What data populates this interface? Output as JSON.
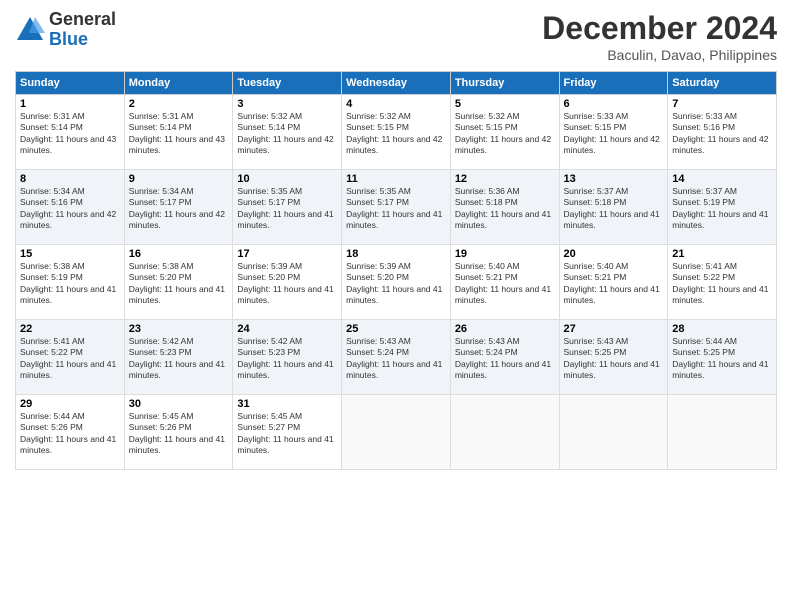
{
  "header": {
    "logo_general": "General",
    "logo_blue": "Blue",
    "month_title": "December 2024",
    "location": "Baculin, Davao, Philippines"
  },
  "weekdays": [
    "Sunday",
    "Monday",
    "Tuesday",
    "Wednesday",
    "Thursday",
    "Friday",
    "Saturday"
  ],
  "weeks": [
    [
      {
        "day": "1",
        "sunrise": "5:31 AM",
        "sunset": "5:14 PM",
        "daylight": "11 hours and 43 minutes."
      },
      {
        "day": "2",
        "sunrise": "5:31 AM",
        "sunset": "5:14 PM",
        "daylight": "11 hours and 43 minutes."
      },
      {
        "day": "3",
        "sunrise": "5:32 AM",
        "sunset": "5:14 PM",
        "daylight": "11 hours and 42 minutes."
      },
      {
        "day": "4",
        "sunrise": "5:32 AM",
        "sunset": "5:15 PM",
        "daylight": "11 hours and 42 minutes."
      },
      {
        "day": "5",
        "sunrise": "5:32 AM",
        "sunset": "5:15 PM",
        "daylight": "11 hours and 42 minutes."
      },
      {
        "day": "6",
        "sunrise": "5:33 AM",
        "sunset": "5:15 PM",
        "daylight": "11 hours and 42 minutes."
      },
      {
        "day": "7",
        "sunrise": "5:33 AM",
        "sunset": "5:16 PM",
        "daylight": "11 hours and 42 minutes."
      }
    ],
    [
      {
        "day": "8",
        "sunrise": "5:34 AM",
        "sunset": "5:16 PM",
        "daylight": "11 hours and 42 minutes."
      },
      {
        "day": "9",
        "sunrise": "5:34 AM",
        "sunset": "5:17 PM",
        "daylight": "11 hours and 42 minutes."
      },
      {
        "day": "10",
        "sunrise": "5:35 AM",
        "sunset": "5:17 PM",
        "daylight": "11 hours and 41 minutes."
      },
      {
        "day": "11",
        "sunrise": "5:35 AM",
        "sunset": "5:17 PM",
        "daylight": "11 hours and 41 minutes."
      },
      {
        "day": "12",
        "sunrise": "5:36 AM",
        "sunset": "5:18 PM",
        "daylight": "11 hours and 41 minutes."
      },
      {
        "day": "13",
        "sunrise": "5:37 AM",
        "sunset": "5:18 PM",
        "daylight": "11 hours and 41 minutes."
      },
      {
        "day": "14",
        "sunrise": "5:37 AM",
        "sunset": "5:19 PM",
        "daylight": "11 hours and 41 minutes."
      }
    ],
    [
      {
        "day": "15",
        "sunrise": "5:38 AM",
        "sunset": "5:19 PM",
        "daylight": "11 hours and 41 minutes."
      },
      {
        "day": "16",
        "sunrise": "5:38 AM",
        "sunset": "5:20 PM",
        "daylight": "11 hours and 41 minutes."
      },
      {
        "day": "17",
        "sunrise": "5:39 AM",
        "sunset": "5:20 PM",
        "daylight": "11 hours and 41 minutes."
      },
      {
        "day": "18",
        "sunrise": "5:39 AM",
        "sunset": "5:20 PM",
        "daylight": "11 hours and 41 minutes."
      },
      {
        "day": "19",
        "sunrise": "5:40 AM",
        "sunset": "5:21 PM",
        "daylight": "11 hours and 41 minutes."
      },
      {
        "day": "20",
        "sunrise": "5:40 AM",
        "sunset": "5:21 PM",
        "daylight": "11 hours and 41 minutes."
      },
      {
        "day": "21",
        "sunrise": "5:41 AM",
        "sunset": "5:22 PM",
        "daylight": "11 hours and 41 minutes."
      }
    ],
    [
      {
        "day": "22",
        "sunrise": "5:41 AM",
        "sunset": "5:22 PM",
        "daylight": "11 hours and 41 minutes."
      },
      {
        "day": "23",
        "sunrise": "5:42 AM",
        "sunset": "5:23 PM",
        "daylight": "11 hours and 41 minutes."
      },
      {
        "day": "24",
        "sunrise": "5:42 AM",
        "sunset": "5:23 PM",
        "daylight": "11 hours and 41 minutes."
      },
      {
        "day": "25",
        "sunrise": "5:43 AM",
        "sunset": "5:24 PM",
        "daylight": "11 hours and 41 minutes."
      },
      {
        "day": "26",
        "sunrise": "5:43 AM",
        "sunset": "5:24 PM",
        "daylight": "11 hours and 41 minutes."
      },
      {
        "day": "27",
        "sunrise": "5:43 AM",
        "sunset": "5:25 PM",
        "daylight": "11 hours and 41 minutes."
      },
      {
        "day": "28",
        "sunrise": "5:44 AM",
        "sunset": "5:25 PM",
        "daylight": "11 hours and 41 minutes."
      }
    ],
    [
      {
        "day": "29",
        "sunrise": "5:44 AM",
        "sunset": "5:26 PM",
        "daylight": "11 hours and 41 minutes."
      },
      {
        "day": "30",
        "sunrise": "5:45 AM",
        "sunset": "5:26 PM",
        "daylight": "11 hours and 41 minutes."
      },
      {
        "day": "31",
        "sunrise": "5:45 AM",
        "sunset": "5:27 PM",
        "daylight": "11 hours and 41 minutes."
      },
      null,
      null,
      null,
      null
    ]
  ]
}
